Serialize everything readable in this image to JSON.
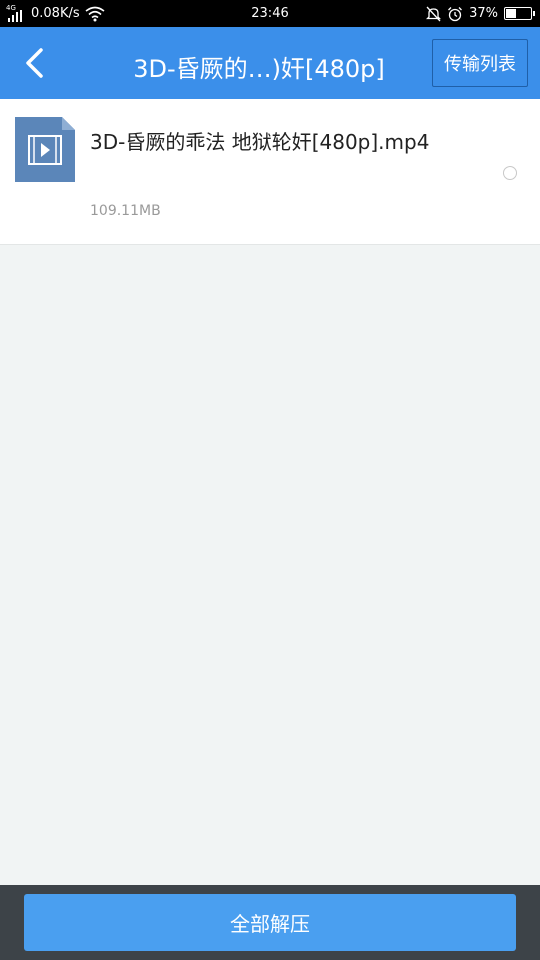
{
  "status_bar": {
    "network_type": "4G",
    "speed": "0.08K/s",
    "time": "23:46",
    "battery": "37%",
    "battery_level": 0.37
  },
  "header": {
    "title": "3D-昏厥的…)奸[480p]",
    "transfer_list_label": "传输列表"
  },
  "file": {
    "name": "3D-昏厥的乖法 地狱轮奸[480p].mp4",
    "size": "109.11MB",
    "icon": "video-file-icon",
    "selected": false
  },
  "footer": {
    "extract_all_label": "全部解压"
  },
  "colors": {
    "header_bg": "#3b8fea",
    "button_bg": "#4a9ff0",
    "bottom_bar_bg": "#3d4348",
    "content_bg": "#f1f4f4",
    "file_icon_bg": "#5b86b9"
  }
}
